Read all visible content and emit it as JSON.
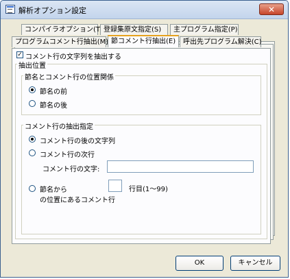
{
  "window": {
    "title": "解析オプション設定",
    "close_label": "✕"
  },
  "tabs_row1": [
    {
      "label": "コンパイラオプション(T)"
    },
    {
      "label": "登録集原文指定(S)"
    },
    {
      "label": "主プログラム指定(P)"
    }
  ],
  "tabs_row2": [
    {
      "label": "プログラムコメント行抽出(M)"
    },
    {
      "label": "節コメント行抽出(E)",
      "active": true
    },
    {
      "label": "呼出先プログラム解決(C)"
    }
  ],
  "panel": {
    "extract_checkbox": {
      "label": "コメント行の文字列を抽出する",
      "checked": true,
      "mark": "✓"
    },
    "extract_position": {
      "legend": "抽出位置",
      "relation": {
        "legend": "節名とコメント行の位置関係",
        "options": [
          {
            "label": "節名の前",
            "selected": true
          },
          {
            "label": "節名の後",
            "selected": false
          }
        ]
      },
      "spec": {
        "legend": "コメント行の抽出指定",
        "options": [
          {
            "label": "コメント行の後の文字列",
            "selected": true
          },
          {
            "label": "コメント行の次行",
            "selected": false
          }
        ],
        "comment_text_label": "コメント行の文字:",
        "comment_text_value": "",
        "from_section_label_line1": "節名から",
        "from_section_label_line2": "の位置にあるコメント行",
        "line_value": "",
        "line_suffix": "行目(1～99)"
      }
    }
  },
  "buttons": {
    "ok": "OK",
    "cancel": "キャンセル"
  }
}
